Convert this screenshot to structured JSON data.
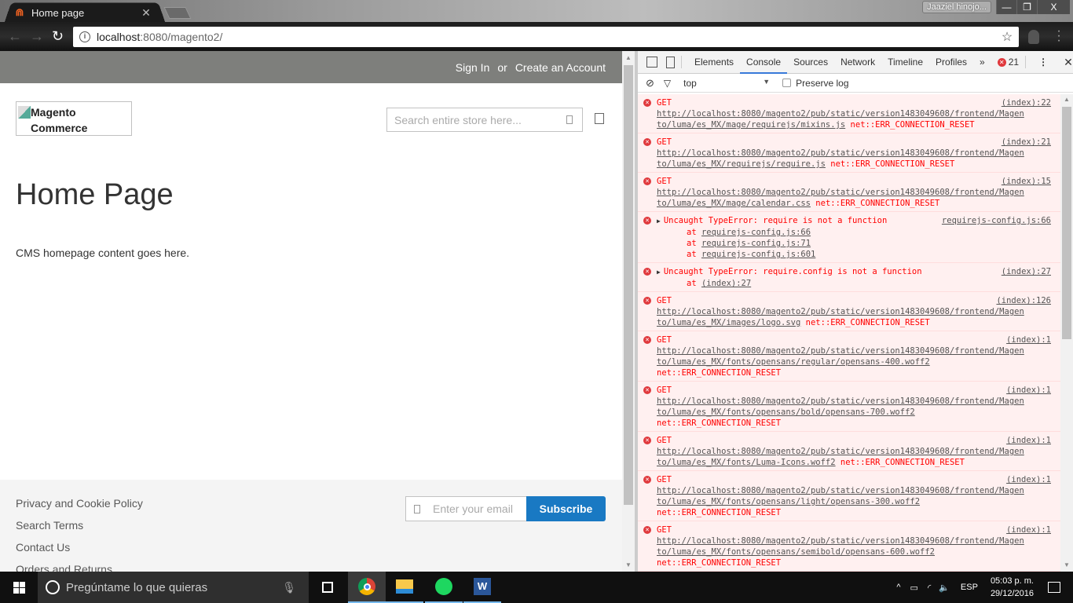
{
  "browser": {
    "tab_title": "Home page",
    "profile_name": "Jaaziel hinojo...",
    "url_host": "localhost",
    "url_rest": ":8080/magento2/",
    "window_controls": {
      "minimize": "—",
      "restore": "❐",
      "close": "X"
    }
  },
  "page": {
    "header_links": {
      "sign_in": "Sign In",
      "or": "or",
      "create_account": "Create an Account"
    },
    "logo_alt_line1": "Magento",
    "logo_alt_line2": "Commerce",
    "search_placeholder": "Search entire store here...",
    "title": "Home Page",
    "cms_text": "CMS homepage content goes here.",
    "footer_links": [
      "Privacy and Cookie Policy",
      "Search Terms",
      "Contact Us",
      "Orders and Returns"
    ],
    "newsletter_placeholder": "Enter your email a",
    "subscribe_label": "Subscribe",
    "subscribe_color": "#1979c3"
  },
  "devtools": {
    "tabs": [
      "Elements",
      "Console",
      "Sources",
      "Network",
      "Timeline",
      "Profiles"
    ],
    "active_tab": "Console",
    "more_tabs": "»",
    "error_count": "21",
    "context": "top",
    "preserve_log_label": "Preserve log",
    "messages": [
      {
        "type": "GET",
        "src": "(index):22",
        "url1": "http://localhost:8080/magento2/pub/static/version1483049608/frontend/Magen",
        "url2": "to/luma/es_MX/mage/requirejs/mixins.js",
        "err": "net::ERR_CONNECTION_RESET"
      },
      {
        "type": "GET",
        "src": "(index):21",
        "url1": "http://localhost:8080/magento2/pub/static/version1483049608/frontend/Magen",
        "url2": "to/luma/es_MX/requirejs/require.js",
        "err": "net::ERR_CONNECTION_RESET"
      },
      {
        "type": "GET",
        "src": "(index):15",
        "url1": "http://localhost:8080/magento2/pub/static/version1483049608/frontend/Magen",
        "url2": "to/luma/es_MX/mage/calendar.css",
        "err": "net::ERR_CONNECTION_RESET"
      },
      {
        "type": "Uncaught TypeError: require is not a function",
        "src": "requirejs-config.js:66",
        "stack": [
          "requirejs-config.js:66",
          "requirejs-config.js:71",
          "requirejs-config.js:601"
        ]
      },
      {
        "type": "Uncaught TypeError: require.config is not a function",
        "src": "(index):27",
        "stack": [
          "(index):27"
        ]
      },
      {
        "type": "GET",
        "src": "(index):126",
        "url1": "http://localhost:8080/magento2/pub/static/version1483049608/frontend/Magen",
        "url2": "to/luma/es_MX/images/logo.svg",
        "err": "net::ERR_CONNECTION_RESET"
      },
      {
        "type": "GET",
        "src": "(index):1",
        "url1": "http://localhost:8080/magento2/pub/static/version1483049608/frontend/Magen",
        "url2": "to/luma/es_MX/fonts/opensans/regular/opensans-400.woff2",
        "err": "net::ERR_CONNECTION_RESET",
        "err_newline": true
      },
      {
        "type": "GET",
        "src": "(index):1",
        "url1": "http://localhost:8080/magento2/pub/static/version1483049608/frontend/Magen",
        "url2": "to/luma/es_MX/fonts/opensans/bold/opensans-700.woff2",
        "err": "net::ERR_CONNECTION_RESET",
        "err_newline": true
      },
      {
        "type": "GET",
        "src": "(index):1",
        "url1": "http://localhost:8080/magento2/pub/static/version1483049608/frontend/Magen",
        "url2": "to/luma/es_MX/fonts/Luma-Icons.woff2",
        "err": "net::ERR_CONNECTION_RESET"
      },
      {
        "type": "GET",
        "src": "(index):1",
        "url1": "http://localhost:8080/magento2/pub/static/version1483049608/frontend/Magen",
        "url2": "to/luma/es_MX/fonts/opensans/light/opensans-300.woff2",
        "err": "net::ERR_CONNECTION_RESET",
        "err_newline": true
      },
      {
        "type": "GET",
        "src": "(index):1",
        "url1": "http://localhost:8080/magento2/pub/static/version1483049608/frontend/Magen",
        "url2": "to/luma/es_MX/fonts/opensans/semibold/opensans-600.woff2",
        "err": "net::ERR_CONNECTION_RESET",
        "err_newline": true
      },
      {
        "type": "GET",
        "src": "(index):1",
        "url1": "http://localhost:8080/magento2/pub/static/version1483049608/frontend/Magen",
        "url2": "",
        "err": ""
      }
    ]
  },
  "taskbar": {
    "search_placeholder": "Pregúntame lo que quieras",
    "apps": [
      "task-view",
      "chrome",
      "file-explorer",
      "spotify",
      "word"
    ],
    "language": "ESP",
    "time": "05:03 p. m.",
    "date": "29/12/2016"
  }
}
